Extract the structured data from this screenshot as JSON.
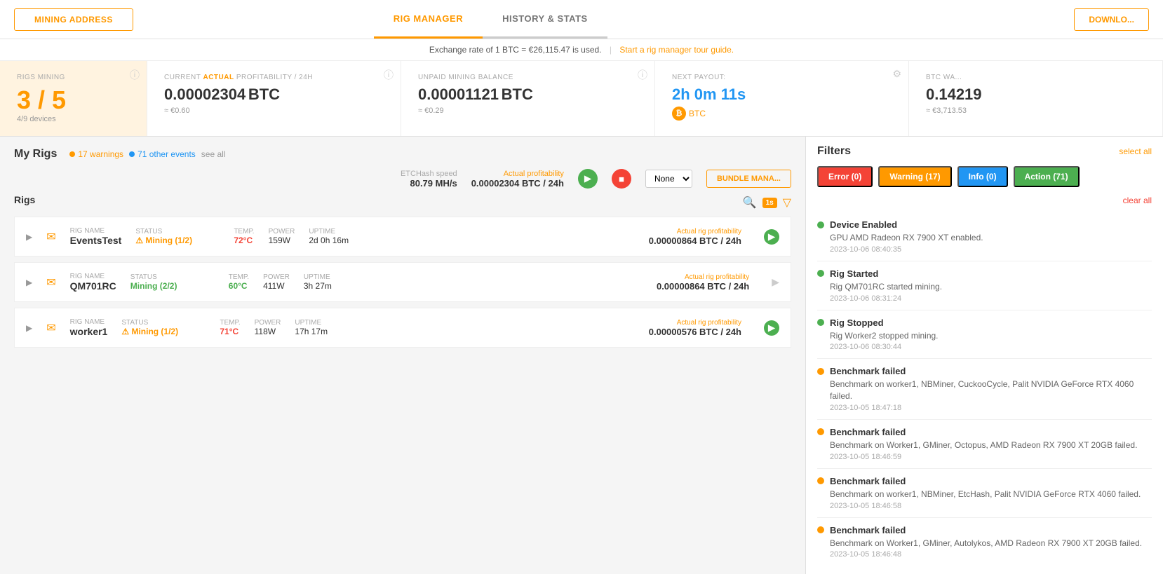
{
  "nav": {
    "mining_address": "MINING ADDRESS",
    "tab_rig_manager": "RIG MANAGER",
    "tab_history": "HISTORY & STATS",
    "download": "DOWNLO..."
  },
  "exchange_bar": {
    "text": "Exchange rate of 1 BTC = €26,115.47 is used.",
    "divider": "|",
    "link_text": "Start a rig manager tour guide."
  },
  "stats": {
    "rigs_mining_label": "RIGS MINING",
    "rigs_value": "3 / 5",
    "devices_label": "4/9 devices",
    "profitability_label": "CURRENT ACTUAL PROFITABILITY / 24H",
    "profitability_value": "0.00002304",
    "profitability_unit": "BTC",
    "profitability_sub": "≈ €0.60",
    "unpaid_label": "UNPAID MINING BALANCE",
    "unpaid_value": "0.00001121",
    "unpaid_unit": "BTC",
    "unpaid_sub": "≈ €0.29",
    "next_payout_label": "NEXT PAYOUT:",
    "next_payout_value": "2h 0m 11s",
    "btc_label": "BTC",
    "btc_wallet_label": "BTC WA...",
    "btc_wallet_value": "0.14219",
    "btc_wallet_sub": "≈ €3,713.53"
  },
  "my_rigs": {
    "title": "My Rigs",
    "warnings_count": "17 warnings",
    "other_events_count": "71 other events",
    "see_all": "see all",
    "speed_label": "ETCHash speed",
    "speed_value": "80.79 MH/s",
    "profit_label": "Actual profitability",
    "profit_value": "0.00002304 BTC / 24h",
    "none_option": "None",
    "bundle_btn": "BUNDLE MANA...",
    "timer_label": "1s"
  },
  "rigs_section": {
    "title": "Rigs",
    "rigs": [
      {
        "name": "EventsTest",
        "name_label": "Rig name",
        "status_label": "Status",
        "status": "Mining (1/2)",
        "status_color": "orange",
        "temp_label": "Temp.",
        "temp": "72°C",
        "temp_color": "red",
        "power_label": "Power",
        "power": "159W",
        "uptime_label": "Uptime",
        "uptime": "2d 0h 16m",
        "prof_label": "Actual rig profitability",
        "prof_value": "0.00000864 BTC / 24h",
        "has_warning": true,
        "play_color": "green"
      },
      {
        "name": "QM701RC",
        "name_label": "Rig name",
        "status_label": "Status",
        "status": "Mining (2/2)",
        "status_color": "green",
        "temp_label": "Temp.",
        "temp": "60°C",
        "temp_color": "green",
        "power_label": "Power",
        "power": "411W",
        "uptime_label": "Uptime",
        "uptime": "3h 27m",
        "prof_label": "Actual rig profitability",
        "prof_value": "0.00000864 BTC / 24h",
        "has_warning": false,
        "play_color": "grey"
      },
      {
        "name": "worker1",
        "name_label": "Rig name",
        "status_label": "Status",
        "status": "Mining (1/2)",
        "status_color": "orange",
        "temp_label": "Temp.",
        "temp": "71°C",
        "temp_color": "red",
        "power_label": "Power",
        "power": "118W",
        "uptime_label": "Uptime",
        "uptime": "17h 17m",
        "prof_label": "Actual rig profitability",
        "prof_value": "0.00000576 BTC / 24h",
        "has_warning": true,
        "play_color": "green"
      }
    ]
  },
  "filters": {
    "title": "Filters",
    "select_all": "select all",
    "clear_all": "clear all",
    "badges": [
      {
        "label": "Error (0)",
        "type": "error"
      },
      {
        "label": "Warning (17)",
        "type": "warning"
      },
      {
        "label": "Info (0)",
        "type": "info"
      },
      {
        "label": "Action (71)",
        "type": "action"
      }
    ],
    "events": [
      {
        "dot": "green",
        "title": "Device Enabled",
        "desc": "GPU AMD Radeon RX 7900 XT enabled.",
        "time": "2023-10-06 08:40:35"
      },
      {
        "dot": "green",
        "title": "Rig Started",
        "desc": "Rig QM701RC started mining.",
        "time": "2023-10-06 08:31:24"
      },
      {
        "dot": "green",
        "title": "Rig Stopped",
        "desc": "Rig Worker2 stopped mining.",
        "time": "2023-10-06 08:30:44"
      },
      {
        "dot": "orange",
        "title": "Benchmark failed",
        "desc": "Benchmark on worker1, NBMiner, CuckooCycle, Palit NVIDIA GeForce RTX 4060 failed.",
        "time": "2023-10-05 18:47:18"
      },
      {
        "dot": "orange",
        "title": "Benchmark failed",
        "desc": "Benchmark on Worker1, GMiner, Octopus, AMD Radeon RX 7900 XT 20GB failed.",
        "time": "2023-10-05 18:46:59"
      },
      {
        "dot": "orange",
        "title": "Benchmark failed",
        "desc": "Benchmark on worker1, NBMiner, EtcHash, Palit NVIDIA GeForce RTX 4060 failed.",
        "time": "2023-10-05 18:46:58"
      },
      {
        "dot": "orange",
        "title": "Benchmark failed",
        "desc": "Benchmark on Worker1, GMiner, Autolykos, AMD Radeon RX 7900 XT 20GB failed.",
        "time": "2023-10-05 18:46:48"
      }
    ]
  }
}
